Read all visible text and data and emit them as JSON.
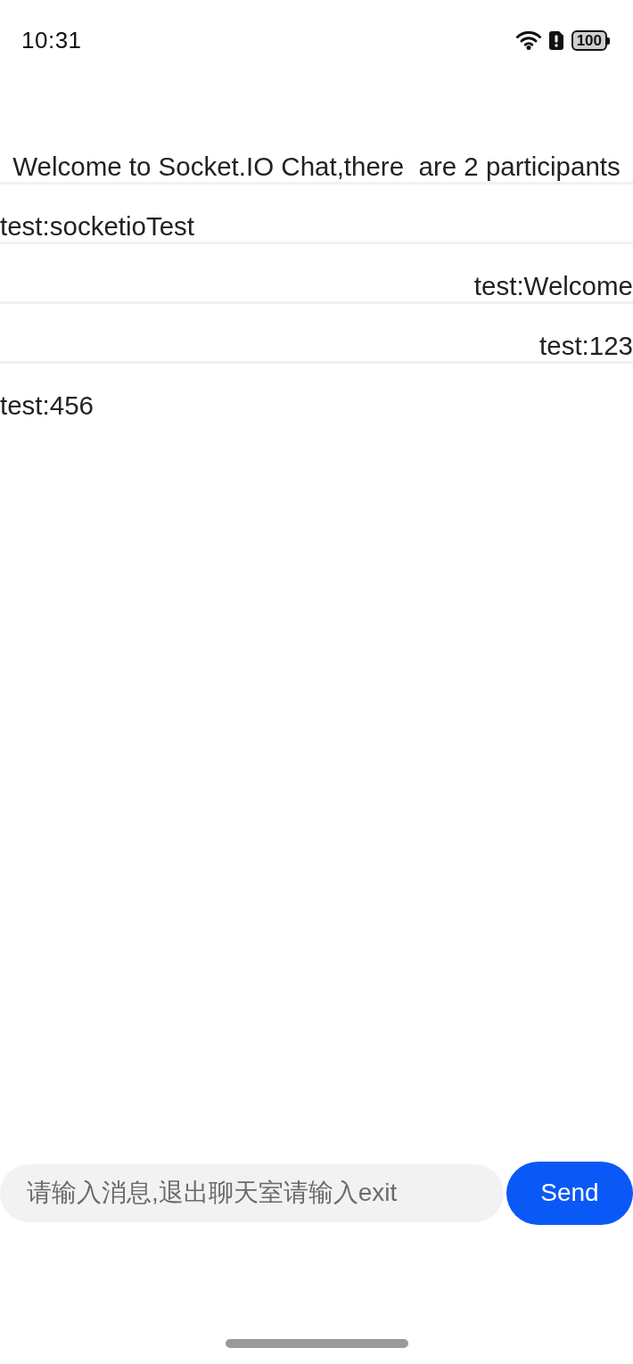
{
  "status_bar": {
    "time": "10:31",
    "battery": "100"
  },
  "chat": {
    "welcome": "Welcome to Socket.IO Chat,there  are 2 participants",
    "messages": [
      {
        "text": "test:socketioTest",
        "outgoing": false
      },
      {
        "text": "test:Welcome",
        "outgoing": true
      },
      {
        "text": "test:123",
        "outgoing": true
      },
      {
        "text": "test:456",
        "outgoing": false
      }
    ]
  },
  "composer": {
    "placeholder": "请输入消息,退出聊天室请输入exit",
    "button": "Send"
  }
}
